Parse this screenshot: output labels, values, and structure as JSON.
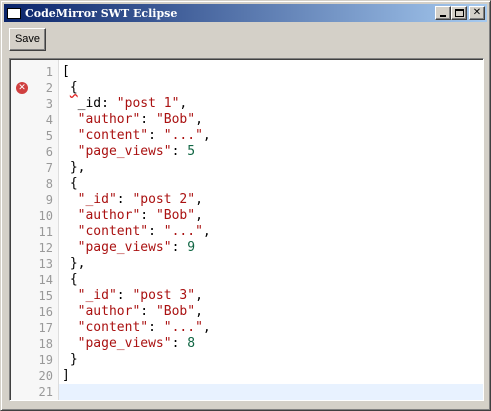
{
  "window": {
    "title": "CodeMirror SWT Eclipse"
  },
  "toolbar": {
    "save_label": "Save"
  },
  "editor": {
    "error_line": 2,
    "active_line": 21,
    "lines": [
      [
        {
          "t": "[",
          "c": "punc"
        }
      ],
      [
        {
          "t": " ",
          "c": "punc"
        },
        {
          "t": "{",
          "c": "punc",
          "err": true
        }
      ],
      [
        {
          "t": "  _id",
          "c": "key"
        },
        {
          "t": ": ",
          "c": "punc"
        },
        {
          "t": "\"post 1\"",
          "c": "str"
        },
        {
          "t": ",",
          "c": "punc"
        }
      ],
      [
        {
          "t": "  ",
          "c": "punc"
        },
        {
          "t": "\"author\"",
          "c": "str"
        },
        {
          "t": ": ",
          "c": "punc"
        },
        {
          "t": "\"Bob\"",
          "c": "str"
        },
        {
          "t": ",",
          "c": "punc"
        }
      ],
      [
        {
          "t": "  ",
          "c": "punc"
        },
        {
          "t": "\"content\"",
          "c": "str"
        },
        {
          "t": ": ",
          "c": "punc"
        },
        {
          "t": "\"...\"",
          "c": "str"
        },
        {
          "t": ",",
          "c": "punc"
        }
      ],
      [
        {
          "t": "  ",
          "c": "punc"
        },
        {
          "t": "\"page_views\"",
          "c": "str"
        },
        {
          "t": ": ",
          "c": "punc"
        },
        {
          "t": "5",
          "c": "num"
        }
      ],
      [
        {
          "t": " },",
          "c": "punc"
        }
      ],
      [
        {
          "t": " {",
          "c": "punc"
        }
      ],
      [
        {
          "t": "  ",
          "c": "punc"
        },
        {
          "t": "\"_id\"",
          "c": "str"
        },
        {
          "t": ": ",
          "c": "punc"
        },
        {
          "t": "\"post 2\"",
          "c": "str"
        },
        {
          "t": ",",
          "c": "punc"
        }
      ],
      [
        {
          "t": "  ",
          "c": "punc"
        },
        {
          "t": "\"author\"",
          "c": "str"
        },
        {
          "t": ": ",
          "c": "punc"
        },
        {
          "t": "\"Bob\"",
          "c": "str"
        },
        {
          "t": ",",
          "c": "punc"
        }
      ],
      [
        {
          "t": "  ",
          "c": "punc"
        },
        {
          "t": "\"content\"",
          "c": "str"
        },
        {
          "t": ": ",
          "c": "punc"
        },
        {
          "t": "\"...\"",
          "c": "str"
        },
        {
          "t": ",",
          "c": "punc"
        }
      ],
      [
        {
          "t": "  ",
          "c": "punc"
        },
        {
          "t": "\"page_views\"",
          "c": "str"
        },
        {
          "t": ": ",
          "c": "punc"
        },
        {
          "t": "9",
          "c": "num"
        }
      ],
      [
        {
          "t": " },",
          "c": "punc"
        }
      ],
      [
        {
          "t": " {",
          "c": "punc"
        }
      ],
      [
        {
          "t": "  ",
          "c": "punc"
        },
        {
          "t": "\"_id\"",
          "c": "str"
        },
        {
          "t": ": ",
          "c": "punc"
        },
        {
          "t": "\"post 3\"",
          "c": "str"
        },
        {
          "t": ",",
          "c": "punc"
        }
      ],
      [
        {
          "t": "  ",
          "c": "punc"
        },
        {
          "t": "\"author\"",
          "c": "str"
        },
        {
          "t": ": ",
          "c": "punc"
        },
        {
          "t": "\"Bob\"",
          "c": "str"
        },
        {
          "t": ",",
          "c": "punc"
        }
      ],
      [
        {
          "t": "  ",
          "c": "punc"
        },
        {
          "t": "\"content\"",
          "c": "str"
        },
        {
          "t": ": ",
          "c": "punc"
        },
        {
          "t": "\"...\"",
          "c": "str"
        },
        {
          "t": ",",
          "c": "punc"
        }
      ],
      [
        {
          "t": "  ",
          "c": "punc"
        },
        {
          "t": "\"page_views\"",
          "c": "str"
        },
        {
          "t": ": ",
          "c": "punc"
        },
        {
          "t": "8",
          "c": "num"
        }
      ],
      [
        {
          "t": " }",
          "c": "punc"
        }
      ],
      [
        {
          "t": "]",
          "c": "punc"
        }
      ],
      []
    ]
  }
}
